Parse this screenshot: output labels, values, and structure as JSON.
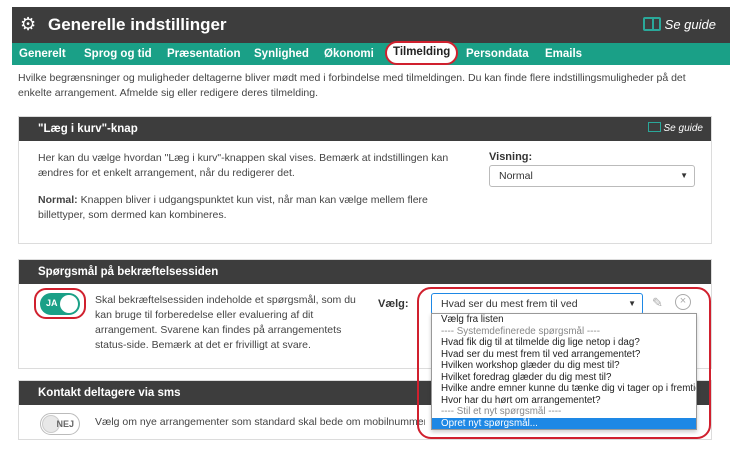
{
  "header": {
    "title": "Generelle indstillinger",
    "guide_label": "Se guide"
  },
  "tabs": [
    {
      "label": "Generelt"
    },
    {
      "label": "Sprog og tid"
    },
    {
      "label": "Præsentation"
    },
    {
      "label": "Synlighed"
    },
    {
      "label": "Økonomi"
    },
    {
      "label": "Tilmelding"
    },
    {
      "label": "Persondata"
    },
    {
      "label": "Emails"
    }
  ],
  "intro": "Hvilke begrænsninger og muligheder deltagerne bliver mødt med i forbindelse med tilmeldingen. Du kan finde flere indstillingsmuligheder på det enkelte arrangement. Afmelde sig eller redigere deres tilmelding.",
  "cart_panel": {
    "title": "\"Læg i kurv\"-knap",
    "guide_label": "Se guide",
    "description": "Her kan du vælge hvordan \"Læg i kurv\"-knappen skal vises. Bemærk at indstillingen kan ændres for et enkelt arrangement, når du redigerer det.",
    "normal_bold": "Normal:",
    "normal_text": " Knappen bliver i udgangspunktet kun vist, når man kan vælge mellem flere billettyper, som dermed kan kombineres.",
    "display_label": "Visning:",
    "display_value": "Normal"
  },
  "question_panel": {
    "title": "Spørgsmål på bekræftelsessiden",
    "toggle_label": "JA",
    "description": "Skal bekræftelsessiden indeholde et spørgsmål, som du kan bruge til forberedelse eller evaluering af dit arrangement. Svarene kan findes på arrangementets status-side. Bemærk at det er frivilligt at svare.",
    "select_label": "Vælg:",
    "select_value": "Hvad ser du mest frem til ved arrangementet?",
    "options": [
      {
        "text": "Vælg fra listen",
        "kind": "item"
      },
      {
        "text": "---- Systemdefinerede spørgsmål ----",
        "kind": "group"
      },
      {
        "text": "Hvad fik dig til at tilmelde dig lige netop i dag?",
        "kind": "item"
      },
      {
        "text": "Hvad ser du mest frem til ved arrangementet?",
        "kind": "item"
      },
      {
        "text": "Hvilken workshop glæder du dig mest til?",
        "kind": "item"
      },
      {
        "text": "Hvilket foredrag glæder du dig mest til?",
        "kind": "item"
      },
      {
        "text": "Hvilke andre emner kunne du tænke dig vi tager op i fremtiden?",
        "kind": "item"
      },
      {
        "text": "Hvor har du hørt om arrangementet?",
        "kind": "item"
      },
      {
        "text": "---- Stil et nyt spørgsmål ----",
        "kind": "group"
      },
      {
        "text": "Opret nyt spørgsmål...",
        "kind": "selected"
      }
    ]
  },
  "sms_panel": {
    "title": "Kontakt deltagere via sms",
    "toggle_label": "NEJ",
    "description": "Vælg om nye arrangementer som standard skal bede om mobilnummer som st"
  },
  "colors": {
    "accent": "#1aa087",
    "dark": "#3d3d3d",
    "highlight": "#d0202e",
    "selection": "#1e88e5"
  }
}
